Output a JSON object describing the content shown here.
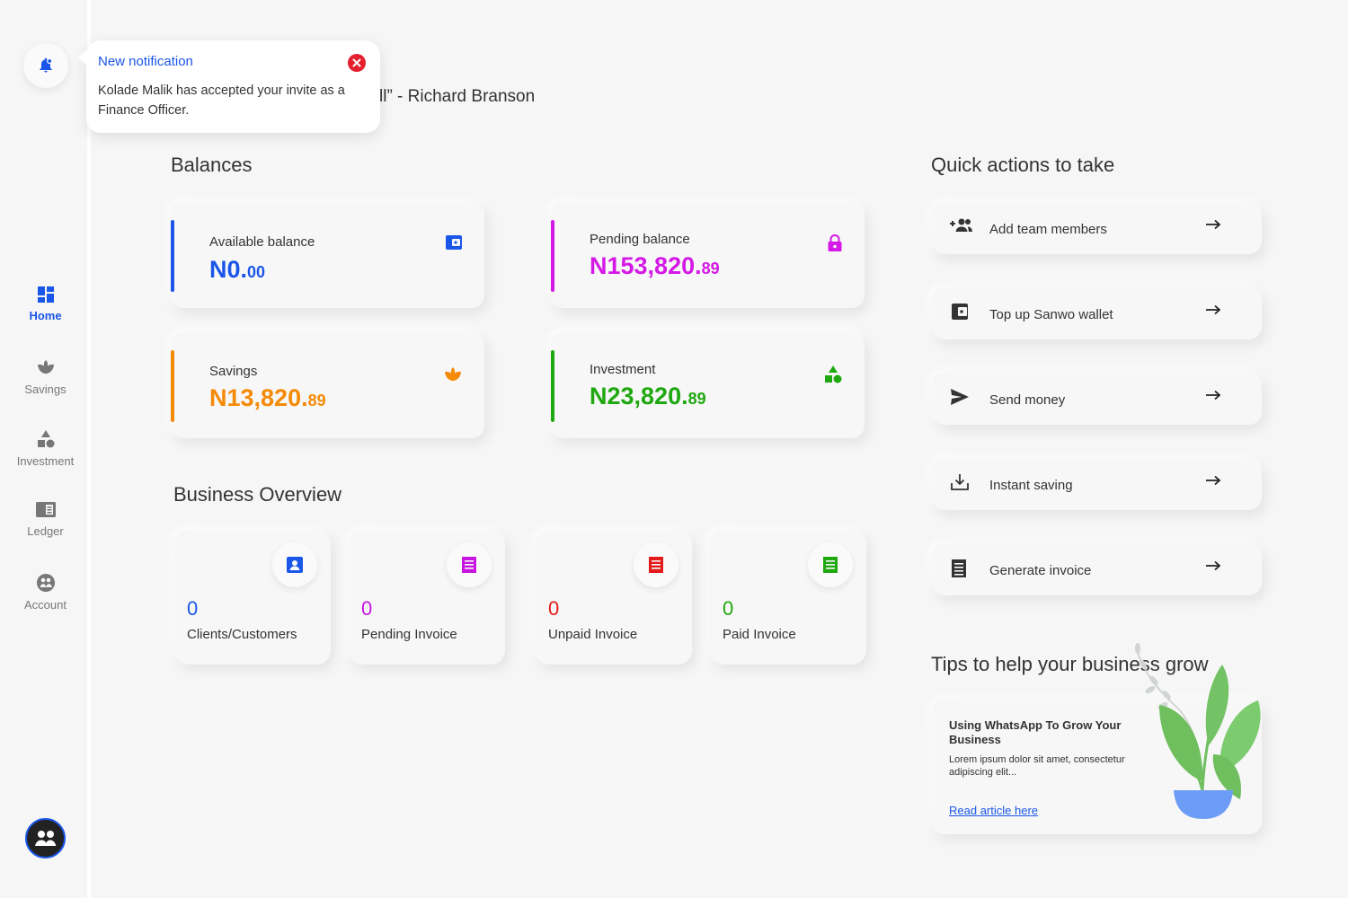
{
  "sidebar": {
    "items": [
      {
        "label": "Home",
        "icon": "dashboard-icon",
        "active": true
      },
      {
        "label": "Savings",
        "icon": "savings-icon"
      },
      {
        "label": "Investment",
        "icon": "investment-icon"
      },
      {
        "label": "Ledger",
        "icon": "ledger-icon"
      },
      {
        "label": "Account",
        "icon": "account-icon"
      }
    ]
  },
  "notification": {
    "title": "New notification",
    "message": "Kolade Malik has accepted your invite as a Finance Officer."
  },
  "quote": {
    "text": "ll” - Richard Branson"
  },
  "balances": {
    "title": "Balances",
    "cards": [
      {
        "label": "Available balance",
        "amount": "N0.",
        "cents": "00",
        "color": "#1a56e8"
      },
      {
        "label": "Pending balance",
        "amount": "N153,820.",
        "cents": "89",
        "color": "#d419e6"
      },
      {
        "label": "Savings",
        "amount": "N13,820.",
        "cents": "89",
        "color": "#f58a07"
      },
      {
        "label": "Investment",
        "amount": "N23,820.",
        "cents": "89",
        "color": "#1fa80f"
      }
    ]
  },
  "overview": {
    "title": "Business Overview",
    "cards": [
      {
        "count": "0",
        "label": "Clients/Customers",
        "color": "#1a56e8"
      },
      {
        "count": "0",
        "label": "Pending Invoice",
        "color": "#c616e0"
      },
      {
        "count": "0",
        "label": "Unpaid Invoice",
        "color": "#e31b1b"
      },
      {
        "count": "0",
        "label": "Paid Invoice",
        "color": "#1fa80f"
      }
    ]
  },
  "quick_actions": {
    "title": "Quick actions to take",
    "items": [
      {
        "label": "Add  team members",
        "icon": "add-team-icon"
      },
      {
        "label": "Top up Sanwo wallet",
        "icon": "wallet-icon"
      },
      {
        "label": "Send money",
        "icon": "send-icon"
      },
      {
        "label": "Instant saving",
        "icon": "download-icon"
      },
      {
        "label": "Generate invoice",
        "icon": "invoice-icon"
      }
    ]
  },
  "tips": {
    "title": "Tips to help your business grow",
    "article": {
      "title": "Using WhatsApp To Grow Your Business",
      "excerpt": "Lorem ipsum dolor sit amet, consectetur adipiscing elit...",
      "link": "Read article here"
    }
  }
}
